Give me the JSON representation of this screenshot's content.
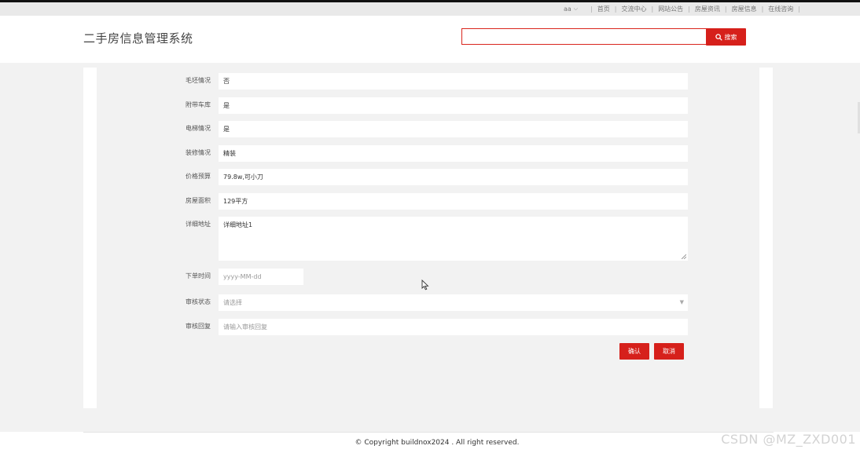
{
  "topbar": {
    "user": "aa",
    "links": [
      "首页",
      "交流中心",
      "网站公告",
      "房屋资讯",
      "房屋信息",
      "在线咨询"
    ]
  },
  "header": {
    "title": "二手房信息管理系统",
    "search_value": "",
    "search_button": "搜索"
  },
  "form": {
    "fields": [
      {
        "label": "毛坯情况",
        "value": "否"
      },
      {
        "label": "附带车库",
        "value": "是"
      },
      {
        "label": "电梯情况",
        "value": "是"
      },
      {
        "label": "装修情况",
        "value": "精装"
      },
      {
        "label": "价格预算",
        "value": "79.8w,可小刀"
      },
      {
        "label": "房屋面积",
        "value": "129平方"
      },
      {
        "label": "详细地址",
        "value": "详细地址1"
      },
      {
        "label": "下单时间",
        "placeholder": "yyyy-MM-dd"
      },
      {
        "label": "审核状态",
        "placeholder": "请选择"
      },
      {
        "label": "审核回复",
        "placeholder": "请输入审核回复"
      }
    ],
    "confirm_label": "确认",
    "cancel_label": "取消"
  },
  "footer": {
    "copyright": "© Copyright buildnox2024 . All right reserved."
  },
  "watermark": "CSDN @MZ_ZXD001",
  "colors": {
    "accent": "#d6201b",
    "background": "#f2f2f2"
  }
}
